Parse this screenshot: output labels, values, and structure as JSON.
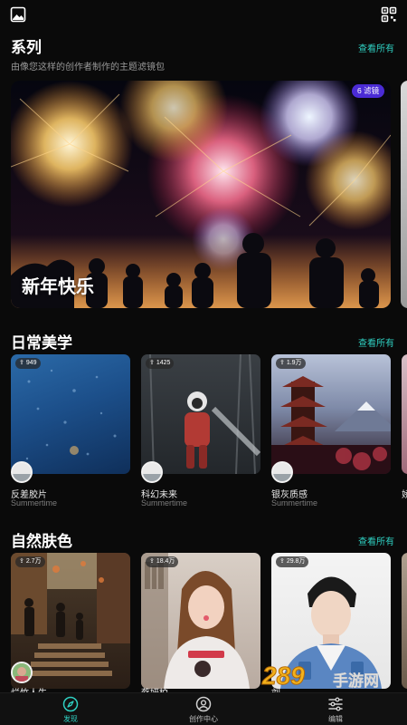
{
  "colors": {
    "accent": "#2fd0c2",
    "background": "#0a0a0a",
    "badge": "#4a2bd6"
  },
  "topbar": {
    "left_icon": "image-icon",
    "right_icon": "qr-scan-icon"
  },
  "series": {
    "title": "系列",
    "subtitle": "由像您这样的创作者制作的主题滤镜包",
    "see_all": "查看所有",
    "hero": {
      "title": "新年快乐",
      "badge": "6 滤镜"
    }
  },
  "daily": {
    "title": "日常美学",
    "see_all": "查看所有",
    "cards": [
      {
        "count": "949",
        "title": "反差胶片",
        "author": "Summertime"
      },
      {
        "count": "1425",
        "title": "科幻未来",
        "author": "Summertime"
      },
      {
        "count": "1.9万",
        "title": "银灰质感",
        "author": "Summertime"
      },
      {
        "title": "娇"
      }
    ]
  },
  "skin": {
    "title": "自然肤色",
    "see_all": "查看所有",
    "cards": [
      {
        "count": "2.7万",
        "title": "烂竹人生"
      },
      {
        "count": "18.4万",
        "title": "蔡妍柏"
      },
      {
        "count": "29.8万",
        "title": "刘"
      }
    ]
  },
  "nav": [
    {
      "label": "发现",
      "icon": "compass-icon",
      "active": true
    },
    {
      "label": "创作中心",
      "icon": "user-circle-icon",
      "active": false
    },
    {
      "label": "编辑",
      "icon": "sliders-icon",
      "active": false
    }
  ],
  "watermark": {
    "brand": "289",
    "sub": "手游网"
  }
}
